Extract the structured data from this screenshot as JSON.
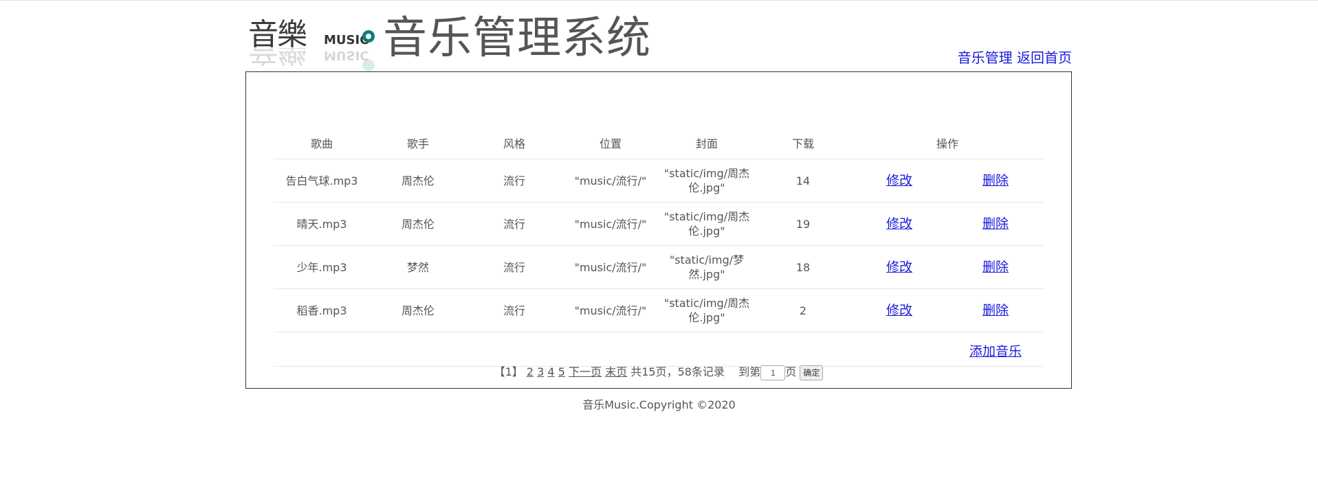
{
  "header": {
    "logo_text": "音樂",
    "logo_music": "MUSIC",
    "title": "音乐管理系统",
    "nav": [
      "音乐管理",
      "返回首页"
    ]
  },
  "table": {
    "columns": [
      "歌曲",
      "歌手",
      "风格",
      "位置",
      "封面",
      "下载",
      "操作"
    ],
    "rows": [
      {
        "song": "告白气球.mp3",
        "singer": "周杰伦",
        "style": "流行",
        "location": "\"music/流行/\"",
        "cover": "\"static/img/周杰伦.jpg\"",
        "downloads": "14",
        "edit": "修改",
        "delete": "删除"
      },
      {
        "song": "晴天.mp3",
        "singer": "周杰伦",
        "style": "流行",
        "location": "\"music/流行/\"",
        "cover": "\"static/img/周杰伦.jpg\"",
        "downloads": "19",
        "edit": "修改",
        "delete": "删除"
      },
      {
        "song": "少年.mp3",
        "singer": "梦然",
        "style": "流行",
        "location": "\"music/流行/\"",
        "cover": "\"static/img/梦然.jpg\"",
        "downloads": "18",
        "edit": "修改",
        "delete": "删除"
      },
      {
        "song": "稻香.mp3",
        "singer": "周杰伦",
        "style": "流行",
        "location": "\"music/流行/\"",
        "cover": "\"static/img/周杰伦.jpg\"",
        "downloads": "2",
        "edit": "修改",
        "delete": "删除"
      }
    ],
    "add_label": "添加音乐"
  },
  "pager": {
    "current": "【1】",
    "pages": [
      "2",
      "3",
      "4",
      "5"
    ],
    "next": "下一页",
    "last": "末页",
    "summary": "共15页，58条记录",
    "goto_prefix": "到第",
    "goto_value": "1",
    "goto_suffix": "页",
    "confirm": "确定"
  },
  "footer": {
    "text": "音乐Music.Copyright ©2020"
  },
  "colors": {
    "link": "#1a1add",
    "text": "#555555",
    "accent": "#0e7c7b"
  }
}
